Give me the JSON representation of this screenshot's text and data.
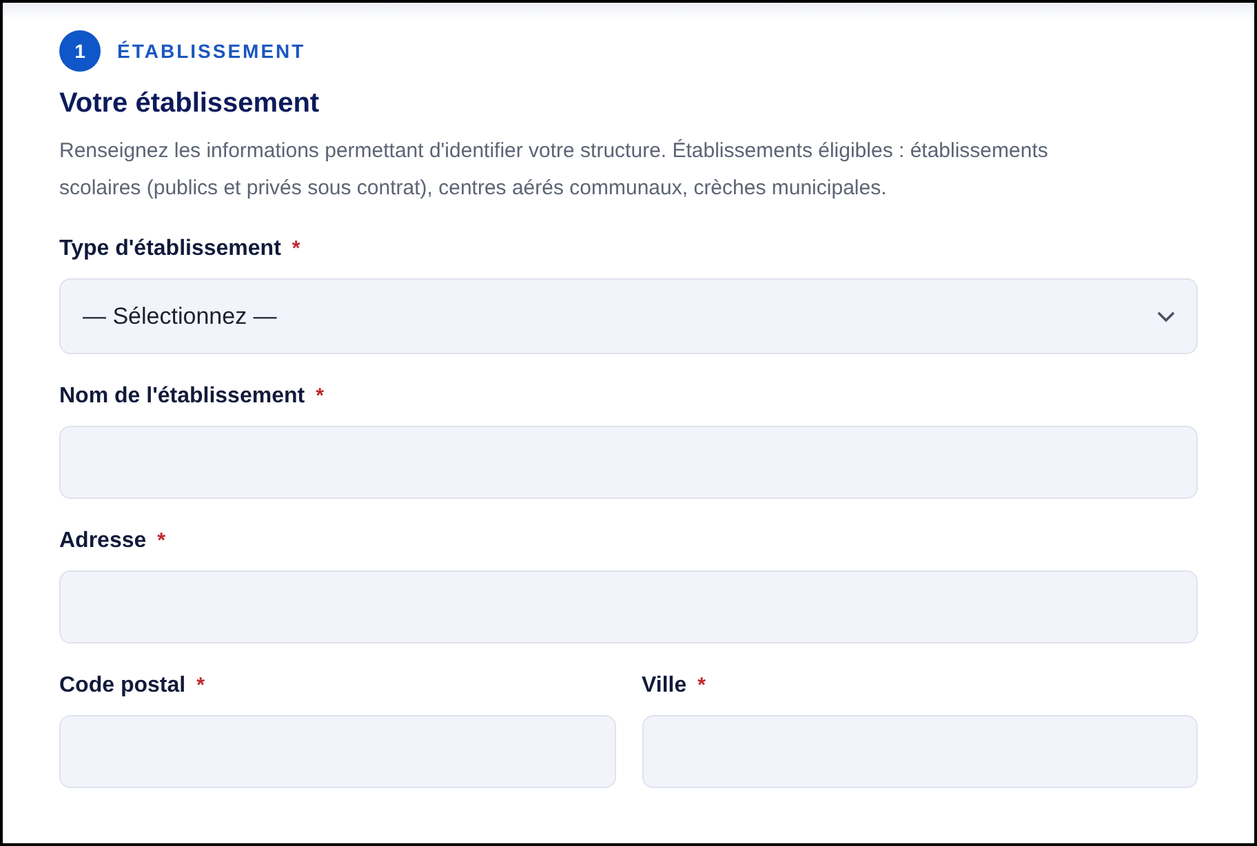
{
  "step": {
    "number": "1",
    "label": "ÉTABLISSEMENT"
  },
  "title": "Votre établissement",
  "description": "Renseignez les informations permettant d'identifier votre structure. Établissements éligibles : établissements scolaires (publics et privés sous contrat), centres aérés communaux, crèches municipales.",
  "rows": [
    [
      {
        "kind": "select",
        "label": "Type d'établissement",
        "required_mark": "*",
        "value": "— Sélectionnez —"
      }
    ],
    [
      {
        "kind": "text",
        "label": "Nom de l'établissement",
        "required_mark": "*"
      }
    ],
    [
      {
        "kind": "text",
        "label": "Adresse",
        "required_mark": "*"
      }
    ],
    [
      {
        "kind": "text",
        "label": "Code postal",
        "required_mark": "*"
      },
      {
        "kind": "text",
        "label": "Ville",
        "required_mark": "*"
      }
    ]
  ]
}
